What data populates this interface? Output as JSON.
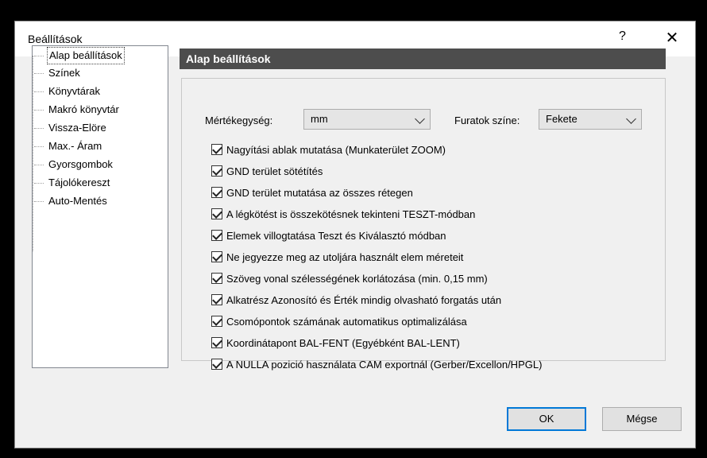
{
  "window": {
    "title": "Beállítások",
    "help_label": "?",
    "close_label": "✕"
  },
  "tree": {
    "items": [
      {
        "label": "Alap beállítások",
        "selected": true
      },
      {
        "label": "Színek"
      },
      {
        "label": "Könyvtárak"
      },
      {
        "label": "Makró könyvtár"
      },
      {
        "label": "Vissza-Elöre"
      },
      {
        "label": "Max.- Áram"
      },
      {
        "label": "Gyorsgombok"
      },
      {
        "label": "Tájolókereszt"
      },
      {
        "label": "Auto-Mentés"
      }
    ]
  },
  "section": {
    "title": "Alap beállítások"
  },
  "units": {
    "label": "Mértékegység:",
    "value": "mm"
  },
  "holes": {
    "label": "Furatok színe:",
    "value": "Fekete"
  },
  "options": [
    {
      "label": "Nagyítási ablak mutatása (Munkaterület ZOOM)",
      "checked": true
    },
    {
      "label": "GND terület sötétítés",
      "checked": true
    },
    {
      "label": "GND terület mutatása az összes rétegen",
      "checked": true
    },
    {
      "label": "A légkötést is összekötésnek tekinteni TESZT-módban",
      "checked": true
    },
    {
      "label": "Elemek villogtatása Teszt és Kiválasztó módban",
      "checked": true
    },
    {
      "label": "Ne jegyezze meg az utoljára használt elem méreteit",
      "checked": true
    },
    {
      "label": "Szöveg vonal szélességének korlátozása (min. 0,15 mm)",
      "checked": true
    },
    {
      "label": "Alkatrész Azonosító és Érték mindig olvasható forgatás után",
      "checked": true
    },
    {
      "label": "Csomópontok számának automatikus optimalizálása",
      "checked": true
    },
    {
      "label": "Koordinátapont BAL-FENT (Egyébként BAL-LENT)",
      "checked": true
    },
    {
      "label": "A NULLA pozició használata CAM exportnál (Gerber/Excellon/HPGL)",
      "checked": true
    }
  ],
  "buttons": {
    "ok": "OK",
    "cancel": "Mégse"
  },
  "colors": {
    "header_bg": "#4d4d4d",
    "default_button_border": "#0078d7"
  }
}
